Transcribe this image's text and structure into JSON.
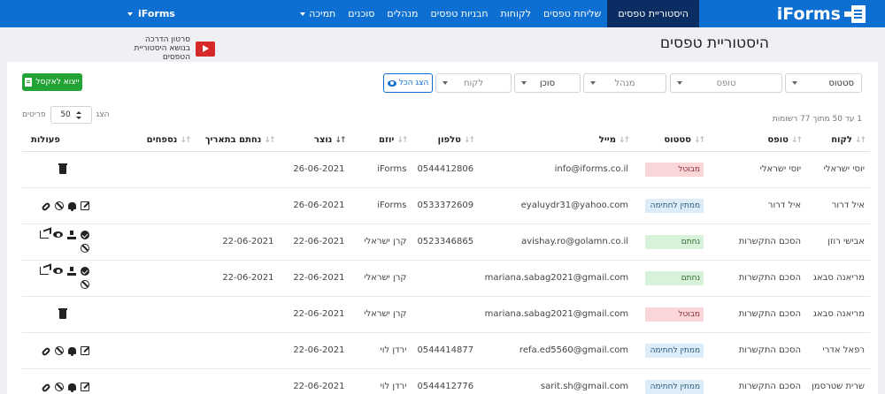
{
  "nav": {
    "brand": "iForms",
    "items": [
      {
        "label": "היסטוריית טפסים",
        "active": true
      },
      {
        "label": "שליחת טפסים"
      },
      {
        "label": "לקוחות"
      },
      {
        "label": "חבניות טפסים"
      },
      {
        "label": "מנהלים"
      },
      {
        "label": "סוכנים"
      },
      {
        "label": "תמיכה",
        "dropdown": true
      }
    ],
    "account": "iForms"
  },
  "header": {
    "title": "היסטוריית טפסים",
    "tutorial": "סרטון הדרכה בנושא היסטוריית הטפסים"
  },
  "filters": {
    "status": "סטטוס",
    "form": "טופס",
    "manager": "מנהל",
    "agent": "סוכן",
    "client": "לקוח",
    "show_all": "הצג הכל",
    "export": "ייצוא לאקסל"
  },
  "paging": {
    "show_label": "הצג",
    "page_size": "50",
    "per_label": "פריטים",
    "records_info": "1 עד 50 מתוך 77 רשומות"
  },
  "table": {
    "headers": [
      "לקוח",
      "טופס",
      "סטטוס",
      "מייל",
      "טלפון",
      "יוזם",
      "נוצר",
      "נחתם בתאריך",
      "נספחים",
      "פעולות"
    ],
    "rows": [
      {
        "client": "יוסי ישראלי",
        "form": "יוסי ישראלי",
        "status": "מבוטל",
        "status_kind": "cancelled",
        "email": "info@iforms.co.il",
        "phone": "0544412806",
        "initiator": "iForms",
        "created": "26-06-2021",
        "signed": "",
        "actions": "trash"
      },
      {
        "client": "איל דרור",
        "form": "איל דרור",
        "status": "ממתין לחתימה",
        "status_kind": "waiting",
        "email": "eyaluydr31@yahoo.com",
        "phone": "0533372609",
        "initiator": "iForms",
        "created": "26-06-2021",
        "signed": "",
        "actions": "pending"
      },
      {
        "client": "אבישי רוזן",
        "form": "הסכם התקשרות",
        "status": "נחתם",
        "status_kind": "signed",
        "email": "avishay.ro@golamn.co.il",
        "phone": "0523346865",
        "initiator": "קרן ישראלי",
        "created": "22-06-2021",
        "signed": "22-06-2021",
        "actions": "signed"
      },
      {
        "client": "מריאנה סבאג",
        "form": "הסכם התקשרות",
        "status": "נחתם",
        "status_kind": "signed",
        "email": "mariana.sabag2021@gmail.com",
        "phone": "",
        "initiator": "קרן ישראלי",
        "created": "22-06-2021",
        "signed": "22-06-2021",
        "actions": "signed"
      },
      {
        "client": "מריאנה סבאג",
        "form": "הסכם התקשרות",
        "status": "מבוטל",
        "status_kind": "cancelled",
        "email": "mariana.sabag2021@gmail.com",
        "phone": "",
        "initiator": "קרן ישראלי",
        "created": "22-06-2021",
        "signed": "",
        "actions": "trash"
      },
      {
        "client": "רפאל אדרי",
        "form": "הסכם התקשרות",
        "status": "ממתין לחתימה",
        "status_kind": "waiting",
        "email": "refa.ed5560@gmail.com",
        "phone": "0544414877",
        "initiator": "ירדן לוי",
        "created": "22-06-2021",
        "signed": "",
        "actions": "pending"
      },
      {
        "client": "שרית שטרסמן",
        "form": "הסכם התקשרות",
        "status": "ממתין לחתימה",
        "status_kind": "waiting",
        "email": "sarit.sh@gmail.com",
        "phone": "0544412776",
        "initiator": "ירדן לוי",
        "created": "22-06-2021",
        "signed": "",
        "actions": "pending"
      }
    ]
  },
  "colors": {
    "nav_bg": "#0d6fd1",
    "nav_active": "#0a2e63",
    "export_green": "#21a336"
  }
}
